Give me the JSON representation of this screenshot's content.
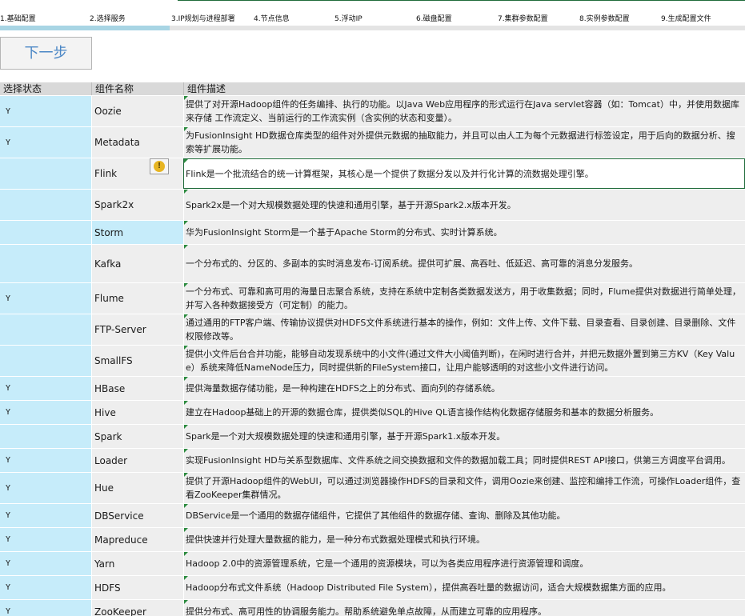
{
  "steps": [
    "1.基础配置",
    "2.选择服务",
    "3.IP规划与进程部署",
    "4.节点信息",
    "5.浮动IP",
    "6.磁盘配置",
    "7.集群参数配置",
    "8.实例参数配置",
    "9.生成配置文件"
  ],
  "progress": {
    "current_step": 2,
    "total_steps": 9
  },
  "next_button": "下一步",
  "table": {
    "headers": [
      "选择状态",
      "组件名称",
      "组件描述"
    ],
    "rows": [
      {
        "status": "Y",
        "name": "Oozie",
        "desc": "提供了对开源Hadoop组件的任务编排、执行的功能。以Java Web应用程序的形式运行在Java servlet容器（如：Tomcat）中，并使用数据库来存储 工作流定义、当前运行的工作流实例（含实例的状态和变量）。"
      },
      {
        "status": "Y",
        "name": "Metadata",
        "desc": "为FusionInsight HD数据仓库类型的组件对外提供元数据的抽取能力，并且可以由人工为每个元数据进行标签设定，用于后向的数据分析、搜索等扩展功能。"
      },
      {
        "status": "",
        "name": "Flink",
        "desc": "Flink是一个批流结合的统一计算框架，其核心是一个提供了数据分发以及并行化计算的流数据处理引擎。"
      },
      {
        "status": "",
        "name": "Spark2x",
        "desc": "Spark2x是一个对大规模数据处理的快速和通用引擎，基于开源Spark2.x版本开发。"
      },
      {
        "status": "",
        "name": "Storm",
        "desc": "华为FusionInsight Storm是一个基于Apache Storm的分布式、实时计算系统。"
      },
      {
        "status": "",
        "name": "Kafka",
        "desc": "一个分布式的、分区的、多副本的实时消息发布-订阅系统。提供可扩展、高吞吐、低延迟、高可靠的消息分发服务。"
      },
      {
        "status": "Y",
        "name": "Flume",
        "desc": "一个分布式、可靠和高可用的海量日志聚合系统，支持在系统中定制各类数据发送方，用于收集数据；同时，Flume提供对数据进行简单处理，并写入各种数据接受方（可定制）的能力。"
      },
      {
        "status": "",
        "name": "FTP-Server",
        "desc": "通过通用的FTP客户端、传输协议提供对HDFS文件系统进行基本的操作，例如：文件上传、文件下载、目录查看、目录创建、目录删除、文件权限修改等。"
      },
      {
        "status": "",
        "name": "SmallFS",
        "desc": "提供小文件后台合并功能，能够自动发现系统中的小文件(通过文件大小阈值判断)，在闲时进行合并，并把元数据外置到第三方KV（Key Value）系统来降低NameNode压力，同时提供新的FileSystem接口，让用户能够透明的对这些小文件进行访问。"
      },
      {
        "status": "Y",
        "name": "HBase",
        "desc": "提供海量数据存储功能，是一种构建在HDFS之上的分布式、面向列的存储系统。"
      },
      {
        "status": "Y",
        "name": "Hive",
        "desc": "建立在Hadoop基础上的开源的数据仓库，提供类似SQL的Hive QL语言操作结构化数据存储服务和基本的数据分析服务。"
      },
      {
        "status": "",
        "name": "Spark",
        "desc": "Spark是一个对大规模数据处理的快速和通用引擎，基于开源Spark1.x版本开发。"
      },
      {
        "status": "Y",
        "name": "Loader",
        "desc": "实现FusionInsight HD与关系型数据库、文件系统之间交换数据和文件的数据加载工具；同时提供REST API接口，供第三方调度平台调用。"
      },
      {
        "status": "Y",
        "name": "Hue",
        "desc": "提供了开源Hadoop组件的WebUI，可以通过浏览器操作HDFS的目录和文件，调用Oozie来创建、监控和编排工作流，可操作Loader组件，查看ZooKeeper集群情况。"
      },
      {
        "status": "Y",
        "name": "DBService",
        "desc": "DBService是一个通用的数据存储组件，它提供了其他组件的数据存储、查询、删除及其他功能。"
      },
      {
        "status": "Y",
        "name": "Mapreduce",
        "desc": "提供快速并行处理大量数据的能力，是一种分布式数据处理模式和执行环境。"
      },
      {
        "status": "Y",
        "name": "Yarn",
        "desc": "Hadoop 2.0中的资源管理系统，它是一个通用的资源模块，可以为各类应用程序进行资源管理和调度。"
      },
      {
        "status": "Y",
        "name": "HDFS",
        "desc": "Hadoop分布式文件系统（Hadoop Distributed File System），提供高吞吐量的数据访问，适合大规模数据集方面的应用。"
      },
      {
        "status": "Y",
        "name": "ZooKeeper",
        "desc": "提供分布式、高可用性的协调服务能力。帮助系统避免单点故障，从而建立可靠的应用程序。"
      }
    ]
  }
}
